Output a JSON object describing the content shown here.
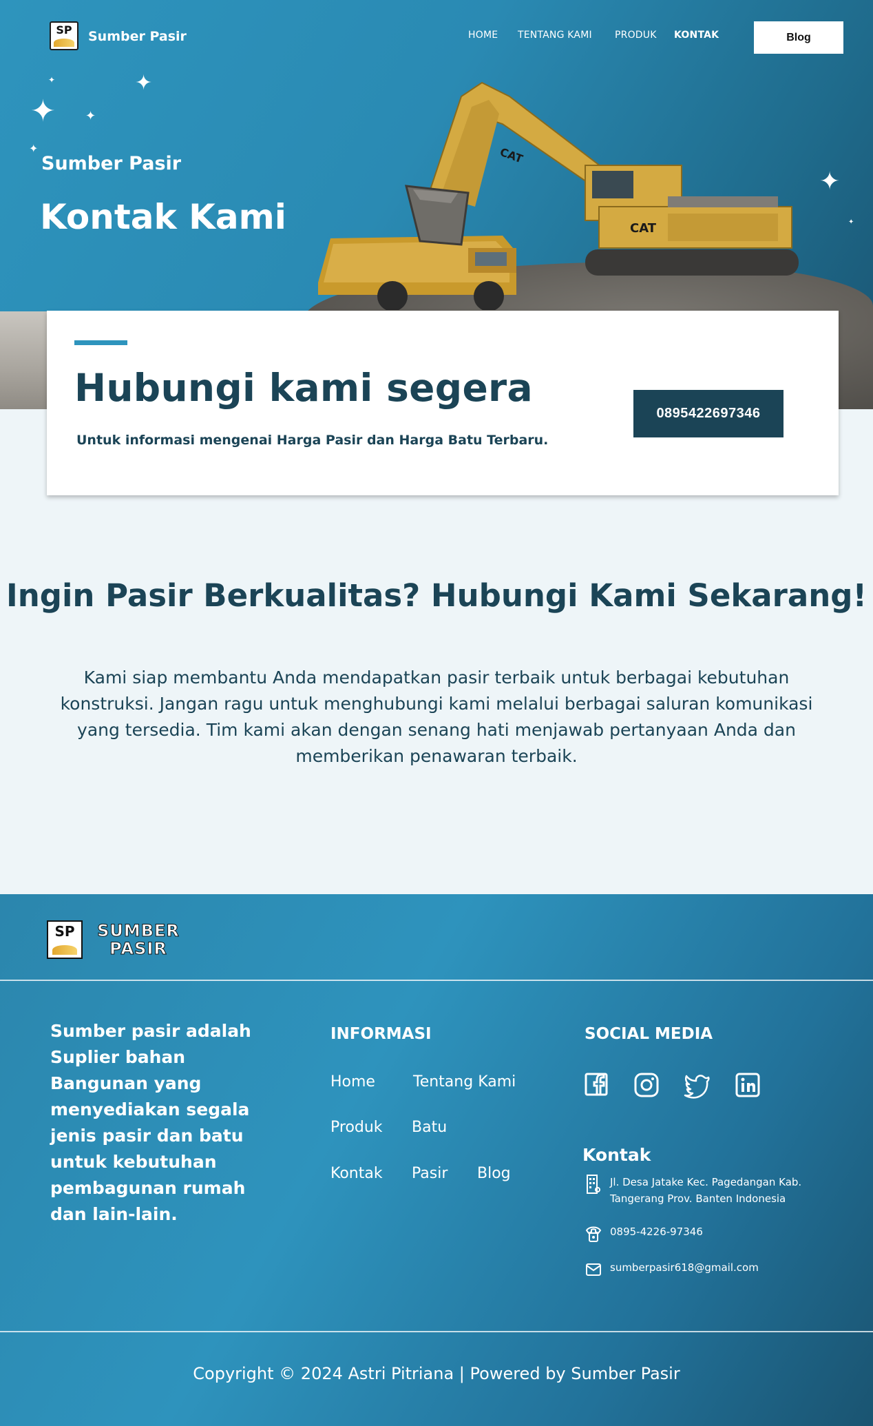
{
  "nav": {
    "logo_text": "SP",
    "brand": "Sumber Pasir",
    "menu": [
      "HOME",
      "TENTANG KAMI",
      "PRODUK",
      "KONTAK"
    ],
    "active_menu": "KONTAK",
    "blog_button": "Blog"
  },
  "hero": {
    "subtitle": "Sumber Pasir",
    "title": "Kontak Kami",
    "excavator_labels": [
      "CAT",
      "CAT"
    ]
  },
  "cta": {
    "heading": "Hubungi kami segera",
    "description": "Untuk informasi mengenai Harga Pasir dan Harga Batu Terbaru.",
    "phone_button": "0895422697346"
  },
  "section": {
    "title": "Ingin Pasir Berkualitas? Hubungi Kami Sekarang!",
    "body": "Kami siap membantu Anda mendapatkan pasir terbaik untuk berbagai kebutuhan konstruksi. Jangan ragu untuk menghubungi kami melalui berbagai saluran komunikasi yang tersedia. Tim kami akan dengan senang hati menjawab pertanyaan Anda dan memberikan penawaran terbaik."
  },
  "footer": {
    "logo_box": "SP",
    "logo_line1": "SUMBER",
    "logo_line2": "PASIR",
    "about": "Sumber pasir adalah Suplier bahan Bangunan yang menyediakan segala jenis pasir dan batu untuk kebutuhan pembagunan rumah dan lain-lain.",
    "info_heading": "INFORMASI",
    "info_links": [
      "Home",
      "Tentang Kami",
      "Produk",
      "Batu",
      "Kontak",
      "Pasir",
      "Blog"
    ],
    "social_heading": "SOCIAL MEDIA",
    "social_icons": [
      "facebook-icon",
      "instagram-icon",
      "twitter-icon",
      "linkedin-icon"
    ],
    "contact_heading": "Kontak",
    "address": "Jl. Desa Jatake Kec. Pagedangan Kab. Tangerang Prov. Banten Indonesia",
    "phone": "0895-4226-97346",
    "email": "sumberpasir618@gmail.com",
    "copyright": "Copyright © 2024 Astri Pitriana | Powered by Sumber Pasir"
  },
  "colors": {
    "primary": "#2e94bd",
    "dark": "#1b4456",
    "background": "#eef5f8",
    "excavator": "#d4aa42"
  }
}
